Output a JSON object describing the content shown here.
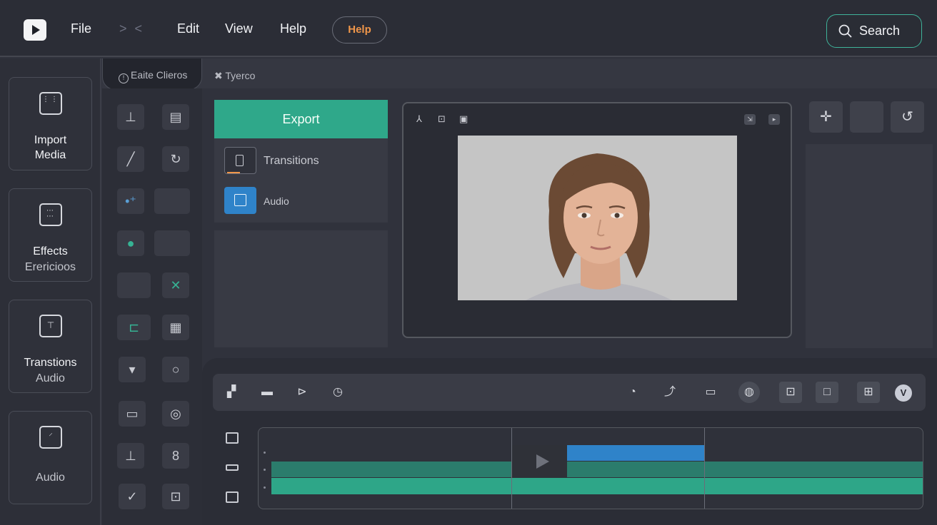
{
  "menu": {
    "file": "File",
    "edit": "Edit",
    "view": "View",
    "help": "Help",
    "nav_arrows": "> <",
    "help_pill": "Help",
    "search_label": "Search"
  },
  "sidebar": {
    "items": [
      {
        "label": "Import",
        "label2": "Media",
        "icon": "grid-icon"
      },
      {
        "label": "Effects",
        "label2": "Erericioos",
        "icon": "dots-grid-icon"
      },
      {
        "label": "Transtions",
        "label2": "Audio",
        "icon": "monitor-icon"
      },
      {
        "label": "",
        "label2": "Audio",
        "icon": "audio-icon"
      }
    ]
  },
  "tabs": {
    "active": "Eaite Clieros",
    "second": "Tyerco"
  },
  "panel": {
    "export_label": "Export",
    "rows": [
      {
        "label": "Transitions",
        "thumb_color": "#2f313a"
      },
      {
        "label": "Audio",
        "thumb_color": "#2f83c9"
      }
    ]
  },
  "timeline": {
    "avatar_letter": "V"
  },
  "colors": {
    "accent_green": "#2fa88a",
    "accent_blue": "#2f83c9",
    "help_orange": "#f0964a",
    "search_border": "#3fb39a"
  }
}
